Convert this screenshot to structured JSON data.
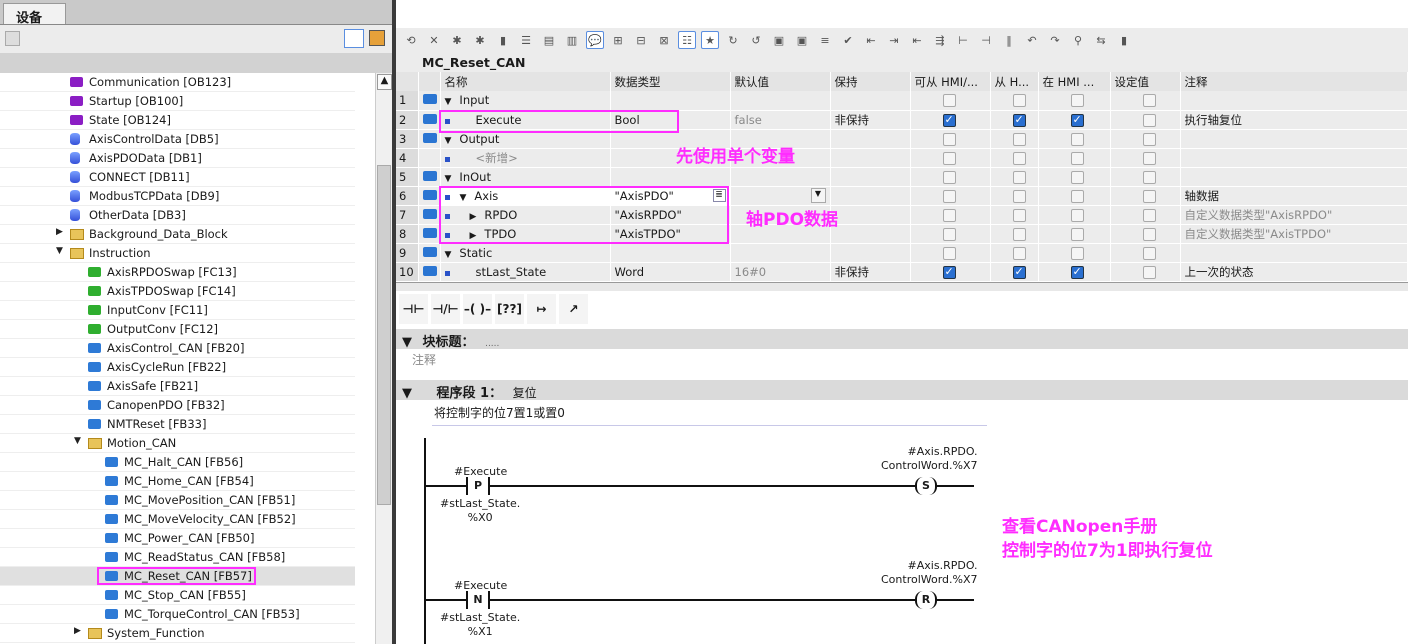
{
  "left_panel": {
    "tab": "设备",
    "tree": [
      {
        "label": "Communication [OB123]",
        "icon": "ob",
        "level": 3
      },
      {
        "label": "Startup [OB100]",
        "icon": "ob",
        "level": 3
      },
      {
        "label": "State [OB124]",
        "icon": "ob",
        "level": 3
      },
      {
        "label": "AxisControlData [DB5]",
        "icon": "db",
        "level": 3
      },
      {
        "label": "AxisPDOData [DB1]",
        "icon": "db",
        "level": 3
      },
      {
        "label": "CONNECT [DB11]",
        "icon": "db",
        "level": 3
      },
      {
        "label": "ModbusTCPData [DB9]",
        "icon": "db",
        "level": 3
      },
      {
        "label": "OtherData [DB3]",
        "icon": "db",
        "level": 3
      },
      {
        "label": "Background_Data_Block",
        "icon": "folder",
        "level": 3,
        "expander": "collapsed"
      },
      {
        "label": "Instruction",
        "icon": "folder",
        "level": 3,
        "expander": "expanded"
      },
      {
        "label": "AxisRPDOSwap [FC13]",
        "icon": "fc",
        "level": 4
      },
      {
        "label": "AxisTPDOSwap [FC14]",
        "icon": "fc",
        "level": 4
      },
      {
        "label": "InputConv [FC11]",
        "icon": "fc",
        "level": 4
      },
      {
        "label": "OutputConv [FC12]",
        "icon": "fc",
        "level": 4
      },
      {
        "label": "AxisControl_CAN [FB20]",
        "icon": "fb",
        "level": 4
      },
      {
        "label": "AxisCycleRun [FB22]",
        "icon": "fb",
        "level": 4
      },
      {
        "label": "AxisSafe [FB21]",
        "icon": "fb",
        "level": 4
      },
      {
        "label": "CanopenPDO [FB32]",
        "icon": "fb",
        "level": 4
      },
      {
        "label": "NMTReset [FB33]",
        "icon": "fb",
        "level": 4
      },
      {
        "label": "Motion_CAN",
        "icon": "folder",
        "level": 4,
        "expander": "expanded"
      },
      {
        "label": "MC_Halt_CAN [FB56]",
        "icon": "fb",
        "level": 5
      },
      {
        "label": "MC_Home_CAN [FB54]",
        "icon": "fb",
        "level": 5
      },
      {
        "label": "MC_MovePosition_CAN [FB51]",
        "icon": "fb",
        "level": 5
      },
      {
        "label": "MC_MoveVelocity_CAN [FB52]",
        "icon": "fb",
        "level": 5
      },
      {
        "label": "MC_Power_CAN [FB50]",
        "icon": "fb",
        "level": 5
      },
      {
        "label": "MC_ReadStatus_CAN [FB58]",
        "icon": "fb",
        "level": 5
      },
      {
        "label": "MC_Reset_CAN [FB57]",
        "icon": "fb",
        "level": 5,
        "selected": true
      },
      {
        "label": "MC_Stop_CAN [FB55]",
        "icon": "fb",
        "level": 5
      },
      {
        "label": "MC_TorqueControl_CAN [FB53]",
        "icon": "fb",
        "level": 5
      },
      {
        "label": "System_Function",
        "icon": "folder",
        "level": 4,
        "expander": "collapsed"
      }
    ]
  },
  "editor": {
    "block_name": "MC_Reset_CAN",
    "columns": [
      "",
      "",
      "名称",
      "数据类型",
      "默认值",
      "保持",
      "可从 HMI/...",
      "从 H...",
      "在 HMI ...",
      "设定值",
      "注释"
    ],
    "rows": [
      {
        "n": "1",
        "name": "Input",
        "section": true,
        "exp": "▼"
      },
      {
        "n": "2",
        "name": "Execute",
        "type": "Bool",
        "default": "false",
        "retain": "非保持",
        "hmi": [
          true,
          true,
          true,
          false
        ],
        "comment": "执行轴复位"
      },
      {
        "n": "3",
        "name": "Output",
        "section": true,
        "exp": "▼"
      },
      {
        "n": "4",
        "name": "<新增>",
        "add": true
      },
      {
        "n": "5",
        "name": "InOut",
        "section": true,
        "exp": "▼"
      },
      {
        "n": "6",
        "name": "Axis",
        "type": "\"AxisPDO\"",
        "exp": "▼",
        "hmi": [
          false,
          false,
          false,
          false
        ],
        "comment": "轴数据",
        "editing": true
      },
      {
        "n": "7",
        "name": "RPDO",
        "type": "\"AxisRPDO\"",
        "exp": "▶",
        "sub": true,
        "comment": "自定义数据类型\"AxisRPDO\"",
        "commentGrey": true
      },
      {
        "n": "8",
        "name": "TPDO",
        "type": "\"AxisTPDO\"",
        "exp": "▶",
        "sub": true,
        "comment": "自定义数据类型\"AxisTPDO\"",
        "commentGrey": true
      },
      {
        "n": "9",
        "name": "Static",
        "section": true,
        "exp": "▼"
      },
      {
        "n": "10",
        "name": "stLast_State",
        "type": "Word",
        "default": "16#0",
        "retain": "非保持",
        "hmi": [
          true,
          true,
          true,
          false
        ],
        "comment": "上一次的状态"
      }
    ],
    "ladder_tools": [
      "⊣⊢",
      "⊣/⊢",
      "–( )–",
      "[??]",
      "↦",
      "↗"
    ],
    "block_title_label": "块标题：",
    "block_title_value": ".....",
    "block_comment": "注释",
    "network_label": "程序段 1：",
    "network_title": "复位",
    "network_comment": "将控制字的位7置1或置0",
    "rungs": [
      {
        "contact_var": "#Execute",
        "contact_type": "P",
        "edge_var_1": "#stLast_State.",
        "edge_var_2": "%X0",
        "coil_var_1": "#Axis.RPDO.",
        "coil_var_2": "ControlWord.%X7",
        "coil_type": "S"
      },
      {
        "contact_var": "#Execute",
        "contact_type": "N",
        "edge_var_1": "#stLast_State.",
        "edge_var_2": "%X1",
        "coil_var_1": "#Axis.RPDO.",
        "coil_var_2": "ControlWord.%X7",
        "coil_type": "R"
      }
    ]
  },
  "annotations": {
    "single_var": "先使用单个变量",
    "axis_pdo": "轴PDO数据",
    "note_line1": "查看CANopen手册",
    "note_line2": "控制字的位7为1即执行复位",
    "color": "#ff2cff"
  }
}
